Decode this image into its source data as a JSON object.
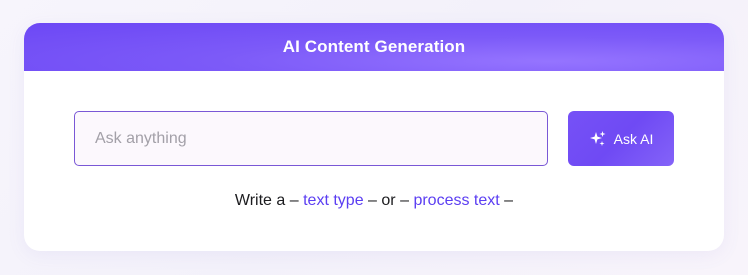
{
  "card": {
    "title": "AI Content Generation"
  },
  "input": {
    "placeholder": "Ask anything",
    "value": ""
  },
  "ask_button": {
    "label": "Ask AI",
    "icon": "sparkle-icon"
  },
  "hint": {
    "prefix": "Write a",
    "dash": "–",
    "link1": "text type",
    "or": "or",
    "link2": "process text"
  },
  "colors": {
    "accent": "#6c47f5",
    "link": "#5b3ef2",
    "input_border": "#7a58d6"
  }
}
